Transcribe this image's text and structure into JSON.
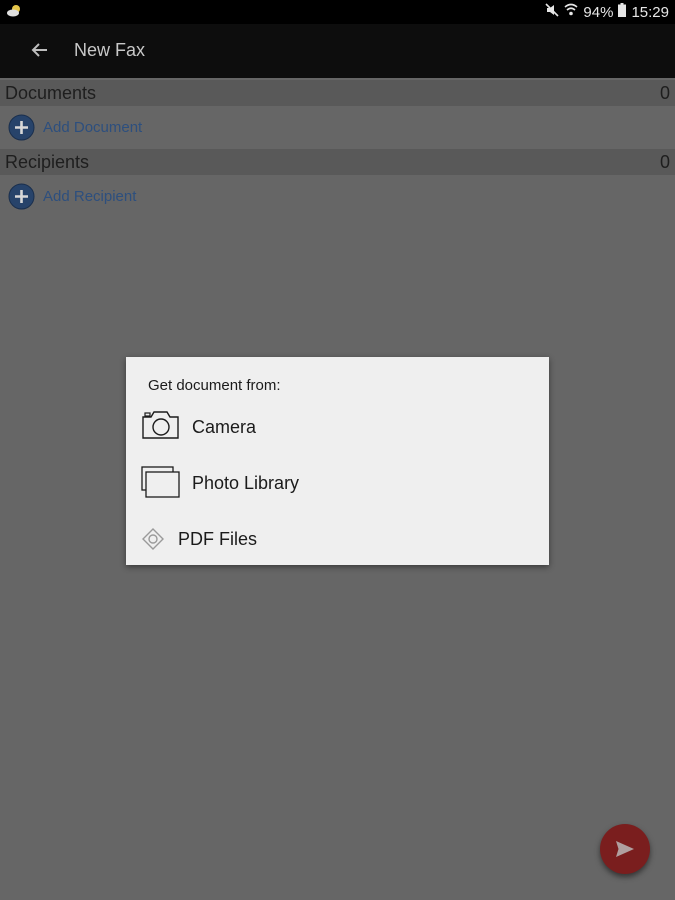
{
  "status_bar": {
    "battery": "94%",
    "time": "15:29",
    "icons": [
      "weather-icon",
      "mute-icon",
      "wifi-icon",
      "battery-icon"
    ]
  },
  "app_bar": {
    "title": "New Fax",
    "back_icon": "arrow-left-icon"
  },
  "documents": {
    "label": "Documents",
    "count": "0",
    "add_label": "Add Document"
  },
  "recipients": {
    "label": "Recipients",
    "count": "0",
    "add_label": "Add Recipient"
  },
  "dialog": {
    "heading": "Get document from:",
    "options": [
      {
        "label": "Camera",
        "icon": "camera-icon"
      },
      {
        "label": "Photo Library",
        "icon": "photo-library-icon"
      },
      {
        "label": "PDF Files",
        "icon": "pdf-files-icon"
      }
    ]
  },
  "fab": {
    "icon": "send-icon"
  },
  "colors": {
    "scrim": "#666666",
    "dialog_bg": "#efefef",
    "link": "#2d4f7e",
    "fab": "#7a1e1e"
  }
}
